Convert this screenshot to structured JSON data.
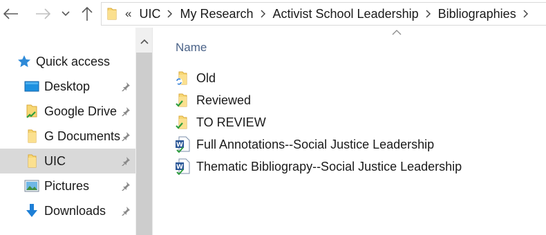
{
  "toolbar": {
    "back_icon": "arrow-left-icon",
    "forward_icon": "arrow-right-icon",
    "recent_icon": "chevron-down-icon",
    "up_icon": "arrow-up-icon"
  },
  "address": {
    "overflow": "«",
    "crumbs": [
      "UIC",
      "My Research",
      "Activist School Leadership",
      "Bibliographies"
    ]
  },
  "sidebar": {
    "items": [
      {
        "label": "Quick access",
        "icon": "star-icon",
        "pinned": false,
        "selected": false
      },
      {
        "label": "Desktop",
        "icon": "desktop-icon",
        "pinned": true,
        "selected": false
      },
      {
        "label": "Google Drive",
        "icon": "folder-synced-icon",
        "pinned": true,
        "selected": false
      },
      {
        "label": "G Documents",
        "icon": "folder-icon",
        "pinned": true,
        "selected": false
      },
      {
        "label": "UIC",
        "icon": "folder-icon",
        "pinned": true,
        "selected": true
      },
      {
        "label": "Pictures",
        "icon": "pictures-icon",
        "pinned": true,
        "selected": false
      },
      {
        "label": "Downloads",
        "icon": "download-icon",
        "pinned": true,
        "selected": false
      }
    ]
  },
  "content": {
    "column_header": "Name",
    "files": [
      {
        "name": "Old",
        "icon": "folder-syncing-icon"
      },
      {
        "name": "Reviewed",
        "icon": "folder-synced-icon"
      },
      {
        "name": "TO REVIEW",
        "icon": "folder-synced-icon"
      },
      {
        "name": "Full Annotations--Social Justice Leadership",
        "icon": "word-document-icon"
      },
      {
        "name": "Thematic Bibliograpy--Social Justice Leadership",
        "icon": "word-document-icon"
      }
    ]
  },
  "colors": {
    "selected_bg": "#d9d9d9",
    "header_text": "#4b6388",
    "folder_yellow": "#f7d774",
    "sync_green": "#2e9e3e",
    "word_blue": "#2b5797"
  }
}
